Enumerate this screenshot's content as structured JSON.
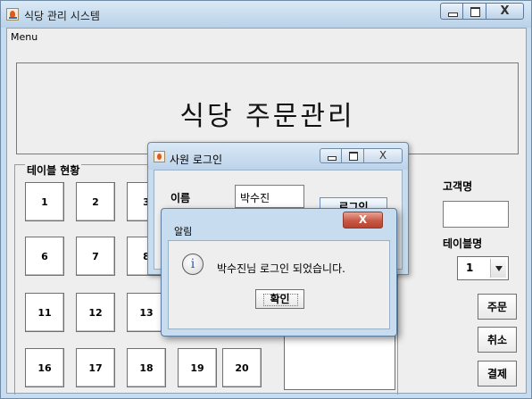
{
  "window": {
    "title": "식당 관리 시스템"
  },
  "menu": {
    "label": "Menu"
  },
  "banner": {
    "text": "식당 주문관리"
  },
  "tables": {
    "group_label": "테이블 현황",
    "buttons": [
      "1",
      "2",
      "3",
      "6",
      "7",
      "8",
      "11",
      "12",
      "13",
      "16",
      "17",
      "18",
      "19",
      "20"
    ]
  },
  "side": {
    "customer_label": "고객명",
    "customer_value": "",
    "table_label": "테이블명",
    "table_selected": "1",
    "order_button": "주문",
    "cancel_button": "취소",
    "pay_button": "결제"
  },
  "login_dialog": {
    "title": "사원 로그인",
    "name_label": "이름",
    "name_value": "박수진",
    "login_button": "로그인"
  },
  "alert_dialog": {
    "title": "알림",
    "close_glyph": "X",
    "icon": "info-icon",
    "message": "박수진님 로그인 되었습니다.",
    "ok_button": "확인"
  }
}
